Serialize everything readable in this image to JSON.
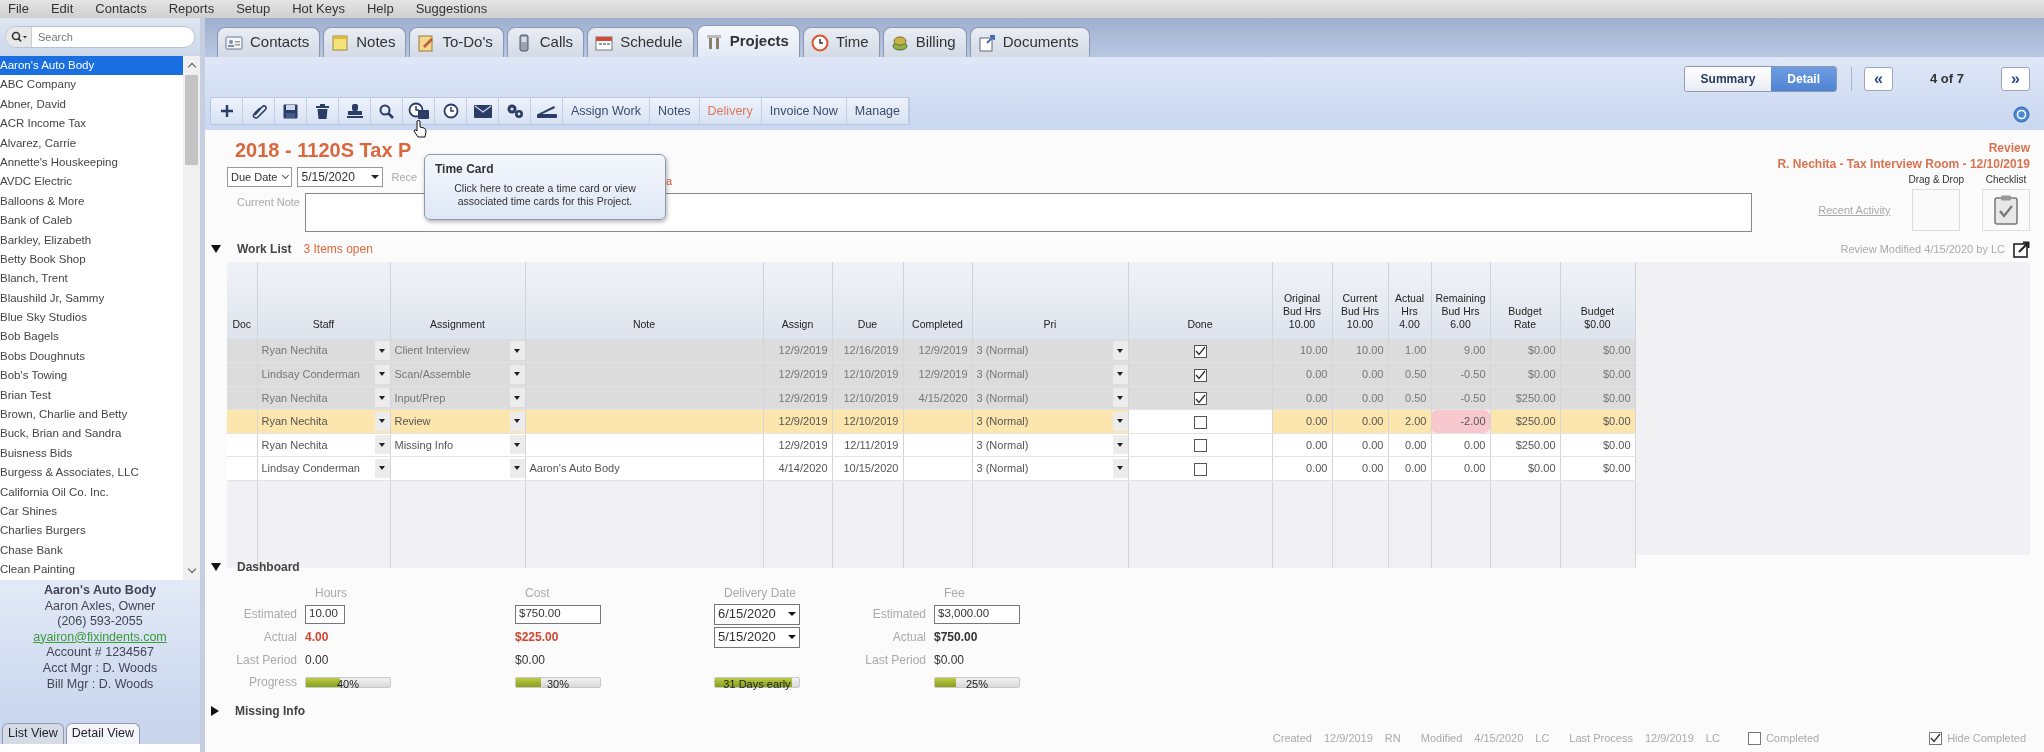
{
  "menu": [
    "File",
    "Edit",
    "Contacts",
    "Reports",
    "Setup",
    "Hot Keys",
    "Help",
    "Suggestions"
  ],
  "sidebar": {
    "search": {
      "placeholder": "Search"
    },
    "contacts": [
      {
        "name": "Aaron's Auto Body",
        "selected": true
      },
      {
        "name": "ABC Company",
        "selected": false
      },
      {
        "name": "Abner, David",
        "selected": false
      },
      {
        "name": "ACR Income Tax",
        "selected": false
      },
      {
        "name": "Alvarez, Carrie",
        "selected": false
      },
      {
        "name": "Annette's Houskeeping",
        "selected": false
      },
      {
        "name": "AVDC Electric",
        "selected": false
      },
      {
        "name": "Balloons & More",
        "selected": false
      },
      {
        "name": "Bank of Caleb",
        "selected": false
      },
      {
        "name": "Barkley, Elizabeth",
        "selected": false
      },
      {
        "name": "Betty Book Shop",
        "selected": false
      },
      {
        "name": "Blanch, Trent",
        "selected": false
      },
      {
        "name": "Blaushild Jr, Sammy",
        "selected": false
      },
      {
        "name": "Blue Sky Studios",
        "selected": false
      },
      {
        "name": "Bob Bagels",
        "selected": false
      },
      {
        "name": "Bobs Doughnuts",
        "selected": false
      },
      {
        "name": "Bob's Towing",
        "selected": false
      },
      {
        "name": "Brian Test",
        "selected": false
      },
      {
        "name": "Brown, Charlie and Betty",
        "selected": false
      },
      {
        "name": "Buck, Brian and Sandra",
        "selected": false
      },
      {
        "name": "Buisness Bids",
        "selected": false
      },
      {
        "name": "Burgess & Associates, LLC",
        "selected": false
      },
      {
        "name": "California Oil Co. Inc.",
        "selected": false
      },
      {
        "name": "Car Shines",
        "selected": false
      },
      {
        "name": "Charlies Burgers",
        "selected": false
      },
      {
        "name": "Chase Bank",
        "selected": false
      },
      {
        "name": "Clean Painting",
        "selected": false
      }
    ],
    "contact_card": {
      "name": "Aaron's Auto Body",
      "lines": [
        "Aaron Axles, Owner",
        "(206) 593-2055"
      ],
      "email": "ayairon@fixindents.com",
      "details": [
        "Account # 1234567",
        "Acct Mgr : D. Woods",
        "Bill Mgr : D. Woods"
      ]
    },
    "view_tabs": [
      {
        "label": "List View",
        "selected": false
      },
      {
        "label": "Detail View",
        "selected": true
      }
    ]
  },
  "tabs": [
    {
      "label": "Contacts",
      "selected": false
    },
    {
      "label": "Notes",
      "selected": false
    },
    {
      "label": "To-Do's",
      "selected": false
    },
    {
      "label": "Calls",
      "selected": false
    },
    {
      "label": "Schedule",
      "selected": false
    },
    {
      "label": "Projects",
      "selected": true
    },
    {
      "label": "Time",
      "selected": false
    },
    {
      "label": "Billing",
      "selected": false
    },
    {
      "label": "Documents",
      "selected": false
    }
  ],
  "view_toggle": [
    {
      "label": "Summary",
      "selected": false
    },
    {
      "label": "Detail",
      "selected": true
    }
  ],
  "pager": {
    "prev": "«",
    "position": "4 of 7",
    "next": "»"
  },
  "toolbar": {
    "text_buttons": [
      {
        "label": "Assign Work",
        "highlighted": false
      },
      {
        "label": "Notes",
        "highlighted": false
      },
      {
        "label": "Delivery",
        "highlighted": true
      },
      {
        "label": "Invoice Now",
        "highlighted": false
      },
      {
        "label": "Manage",
        "highlighted": false
      }
    ]
  },
  "tooltip": {
    "title": "Time Card",
    "text": "Click here to create a time card or view associated time cards for this Project."
  },
  "project": {
    "title": "2018 - 1120S Tax P",
    "due_type": "Due Date",
    "due_date": "5/15/2020",
    "recent_fragment": "Rece",
    "alert_fragment": "a",
    "note_label": "Current Note",
    "status": "Review",
    "event": "R. Nechita - Tax Interview Room - 12/10/2019",
    "recent_activity": "Recent Activity",
    "drag_drop": "Drag & Drop",
    "checklist": "Checklist"
  },
  "work_list": {
    "title": "Work List",
    "expanded": true,
    "open_count": "3 Items open",
    "modified": "Review Modified 4/15/2020 by LC",
    "columns": [
      "Doc",
      "Staff",
      "Assignment",
      "Note",
      "Assign",
      "Due",
      "Completed",
      "Pri",
      "Done",
      "Original\nBud Hrs\n10.00",
      "Current\nBud Hrs\n10.00",
      "Actual\nHrs\n4.00",
      "Remaining\nBud Hrs\n6.00",
      "Budget\nRate",
      "Budget\n$0.00"
    ],
    "rows": [
      {
        "staff": "Ryan  Nechita",
        "assignment": "Client Interview",
        "assign": "12/9/2019",
        "due": "12/16/2019",
        "completed": "12/9/2019",
        "pri": "3 (Normal)",
        "done": true,
        "original": "10.00",
        "current": "10.00",
        "actual": "1.00",
        "remaining": "9.00",
        "rate": "$0.00",
        "budget": "$0.00",
        "selected": false,
        "remaining_alert": false
      },
      {
        "staff": "Lindsay Conderman",
        "assignment": "Scan/Assemble",
        "assign": "12/9/2019",
        "due": "12/10/2019",
        "completed": "12/9/2019",
        "pri": "3 (Normal)",
        "done": true,
        "original": "0.00",
        "current": "0.00",
        "actual": "0.50",
        "remaining": "-0.50",
        "rate": "$0.00",
        "budget": "$0.00",
        "selected": false,
        "remaining_alert": false
      },
      {
        "staff": "Ryan  Nechita",
        "assignment": "Input/Prep",
        "assign": "12/9/2019",
        "due": "12/10/2019",
        "completed": "4/15/2020",
        "pri": "3 (Normal)",
        "done": true,
        "original": "0.00",
        "current": "0.00",
        "actual": "0.50",
        "remaining": "-0.50",
        "rate": "$250.00",
        "budget": "$0.00",
        "selected": false,
        "remaining_alert": false
      },
      {
        "staff": "Ryan  Nechita",
        "assignment": "Review",
        "assign": "12/9/2019",
        "due": "12/10/2019",
        "pri": "3 (Normal)",
        "done": false,
        "original": "0.00",
        "current": "0.00",
        "actual": "2.00",
        "remaining": "-2.00",
        "rate": "$250.00",
        "budget": "$0.00",
        "selected": true,
        "remaining_alert": true
      },
      {
        "staff": "Ryan  Nechita",
        "assignment": "Missing Info",
        "assign": "12/9/2019",
        "due": "12/11/2019",
        "pri": "3 (Normal)",
        "done": false,
        "original": "0.00",
        "current": "0.00",
        "actual": "0.00",
        "remaining": "0.00",
        "rate": "$250.00",
        "budget": "$0.00",
        "selected": false,
        "remaining_alert": false
      },
      {
        "staff": "Lindsay Conderman",
        "note": "Aaron's Auto Body",
        "assign": "4/14/2020",
        "due": "10/15/2020",
        "pri": "3 (Normal)",
        "done": false,
        "original": "0.00",
        "current": "0.00",
        "actual": "0.00",
        "remaining": "0.00",
        "rate": "$0.00",
        "budget": "$0.00",
        "selected": false,
        "remaining_alert": false
      }
    ]
  },
  "dashboard": {
    "title": "Dashboard",
    "expanded": true,
    "columns": [
      {
        "heading": "Hours",
        "kind": "number",
        "labels": [
          "Estimated",
          "Actual",
          "Last Period",
          "Progress"
        ],
        "estimated": "10.00",
        "actual": "4.00",
        "actual_alert": true,
        "last_period": "0.00",
        "progress": {
          "label": "40%",
          "level": 0.4
        }
      },
      {
        "heading": "Cost",
        "kind": "number",
        "estimated": "$750.00",
        "actual": "$225.00",
        "actual_alert": true,
        "last_period": "$0.00",
        "progress": {
          "label": "30%",
          "level": 0.3
        }
      },
      {
        "heading": "Delivery Date",
        "kind": "date",
        "estimated": "6/15/2020",
        "actual": "5/15/2020",
        "progress": {
          "label": "31 Days early",
          "level": 0.92
        }
      },
      {
        "heading": "Fee",
        "kind": "number",
        "labels": [
          "Estimated",
          "Actual",
          "Last Period"
        ],
        "estimated": "$3,000.00",
        "actual": "$750.00",
        "actual_alert": false,
        "last_period": "$0.00",
        "progress": {
          "label": "25%",
          "level": 0.25
        }
      }
    ]
  },
  "missing_info": {
    "title": "Missing Info",
    "expanded": false
  },
  "footer": {
    "audit": [
      {
        "label": "Created",
        "date": "12/9/2019",
        "by": "RN"
      },
      {
        "label": "Modified",
        "date": "4/15/2020",
        "by": "LC"
      },
      {
        "label": "Last Process",
        "date": "12/9/2019",
        "by": "LC"
      }
    ],
    "completed": {
      "label": "Completed",
      "checked": false
    },
    "hide_completed": {
      "label": "Hide Completed",
      "checked": true
    }
  }
}
